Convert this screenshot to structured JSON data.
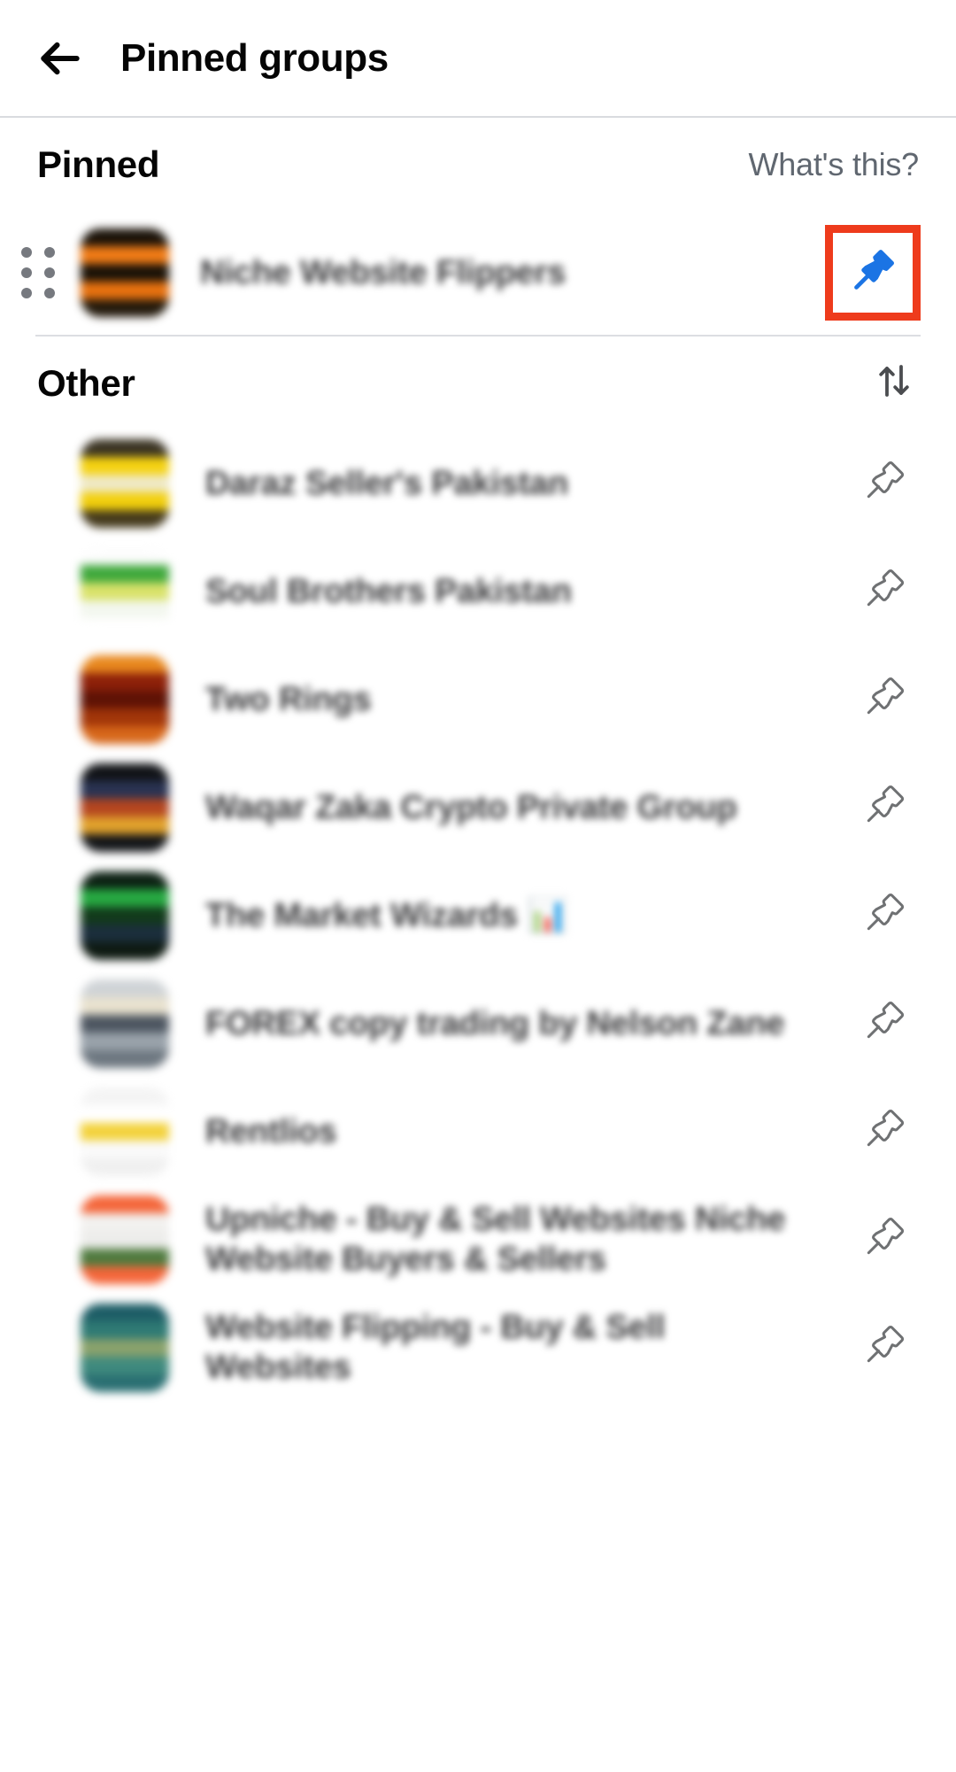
{
  "appbar": {
    "back_icon": "arrow-left-icon",
    "title": "Pinned groups"
  },
  "pinned_section": {
    "title": "Pinned",
    "help_link": "What's this?",
    "items": [
      {
        "name": "Niche Website Flippers",
        "avatar_colors": [
          "#1a1208",
          "#f07b16",
          "#1a1208",
          "#e8720f",
          "#241a0c"
        ],
        "drag_handle_icon": "drag-handle-icon",
        "pin_icon": "pin-filled-icon",
        "pinned": true,
        "highlighted": true
      }
    ]
  },
  "other_section": {
    "title": "Other",
    "sort_icon": "sort-arrows-icon",
    "items": [
      {
        "name": "Daraz Seller's Pakistan",
        "avatar_colors": [
          "#3a3322",
          "#f5d211",
          "#efe9c6",
          "#f2cf0d",
          "#453a1c"
        ],
        "pin_icon": "pin-outline-icon"
      },
      {
        "name": "Soul Brothers Pakistan",
        "avatar_colors": [
          "#fdfdfd",
          "#3fa83c",
          "#d9e26a",
          "#f3f7ef",
          "#ffffff"
        ],
        "pin_icon": "pin-outline-icon"
      },
      {
        "name": "Two Rings",
        "avatar_colors": [
          "#e8881e",
          "#8d2009",
          "#5e1205",
          "#a13509",
          "#d7671a"
        ],
        "pin_icon": "pin-outline-icon"
      },
      {
        "name": "Waqar Zaka Crypto Private Group",
        "avatar_colors": [
          "#111317",
          "#2a3352",
          "#b4451f",
          "#e0a12c",
          "#141619"
        ],
        "pin_icon": "pin-outline-icon"
      },
      {
        "name": "The Market Wizards 📊",
        "avatar_colors": [
          "#0c2113",
          "#27a942",
          "#123a1b",
          "#1b2e3c",
          "#0e1a12"
        ],
        "pin_icon": "pin-outline-icon"
      },
      {
        "name": "FOREX copy trading by Nelson Zane",
        "avatar_colors": [
          "#cfd3d6",
          "#e9e2cf",
          "#4c5560",
          "#9aa3ab",
          "#6d7780"
        ],
        "pin_icon": "pin-outline-icon"
      },
      {
        "name": "Rentlios",
        "avatar_colors": [
          "#f4f4f4",
          "#ffffff",
          "#f3d23c",
          "#fafafa",
          "#f0f0f0"
        ],
        "pin_icon": "pin-outline-icon"
      },
      {
        "name": "Upniche - Buy & Sell Websites Niche Website Buyers & Sellers",
        "avatar_colors": [
          "#f4663a",
          "#f2f1ef",
          "#ededeb",
          "#4f7a3e",
          "#f4663a"
        ],
        "pin_icon": "pin-outline-icon"
      },
      {
        "name": "Website Flipping - Buy & Sell Websites",
        "avatar_colors": [
          "#1d5d66",
          "#2f7a74",
          "#8aa26c",
          "#3f8a7e",
          "#2a6f72"
        ],
        "pin_icon": "pin-outline-icon"
      }
    ]
  },
  "colors": {
    "highlight_red": "#ee3b1c",
    "pin_active_blue": "#1b74e4",
    "pin_outline_gray": "#65676b",
    "text_primary": "#050505",
    "text_secondary": "#606770",
    "divider": "#dcdee2"
  }
}
